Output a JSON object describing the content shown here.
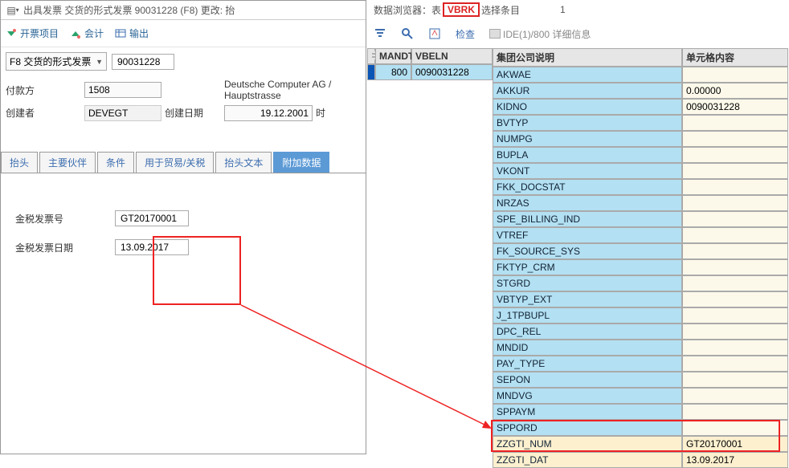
{
  "left": {
    "title": "出具发票 交货的形式发票 90031228   (F8) 更改: 抬",
    "toolbar": {
      "billing_item": "开票项目",
      "accounting": "会计",
      "output": "输出"
    },
    "type_label": "F8 交货的形式发票",
    "doc_number": "90031228",
    "fields": {
      "payer_label": "付款方",
      "payer_value": "1508",
      "payer_desc": "Deutsche Computer AG / Hauptstrasse",
      "creator_label": "创建者",
      "creator_value": "DEVEGT",
      "created_date_label": "创建日期",
      "created_date_value": "19.12.2001",
      "time_label": "时"
    },
    "tabs": {
      "t1": "抬头",
      "t2": "主要伙伴",
      "t3": "条件",
      "t4": "用于贸易/关税",
      "t5": "抬头文本",
      "t6": "附加数据"
    },
    "addl": {
      "gti_num_label": "金税发票号",
      "gti_num_value": "GT20170001",
      "gti_date_label": "金税发票日期",
      "gti_date_value": "13.09.2017"
    }
  },
  "right": {
    "title_prefix": "数据浏览器：表",
    "table_name": "VBRK",
    "title_suffix": "选择条目",
    "count": "1",
    "toolbar": {
      "check": "检查"
    },
    "breadcrumb": "IDE(1)/800 详细信息",
    "list_header": {
      "mandt": "MANDT",
      "vbeln": "VBELN"
    },
    "list_row": {
      "mandt": "800",
      "vbeln": "0090031228"
    },
    "detail_header": {
      "label": "集团公司说明",
      "value": "单元格内容"
    },
    "rows": [
      {
        "k": "AKWAE",
        "v": ""
      },
      {
        "k": "AKKUR",
        "v": "0.00000"
      },
      {
        "k": "KIDNO",
        "v": "0090031228"
      },
      {
        "k": "BVTYP",
        "v": ""
      },
      {
        "k": "NUMPG",
        "v": ""
      },
      {
        "k": "BUPLA",
        "v": ""
      },
      {
        "k": "VKONT",
        "v": ""
      },
      {
        "k": "FKK_DOCSTAT",
        "v": ""
      },
      {
        "k": "NRZAS",
        "v": ""
      },
      {
        "k": "SPE_BILLING_IND",
        "v": ""
      },
      {
        "k": "VTREF",
        "v": ""
      },
      {
        "k": "FK_SOURCE_SYS",
        "v": ""
      },
      {
        "k": "FKTYP_CRM",
        "v": ""
      },
      {
        "k": "STGRD",
        "v": ""
      },
      {
        "k": "VBTYP_EXT",
        "v": ""
      },
      {
        "k": "J_1TPBUPL",
        "v": ""
      },
      {
        "k": "DPC_REL",
        "v": ""
      },
      {
        "k": "MNDID",
        "v": ""
      },
      {
        "k": "PAY_TYPE",
        "v": ""
      },
      {
        "k": "SEPON",
        "v": ""
      },
      {
        "k": "MNDVG",
        "v": ""
      },
      {
        "k": "SPPAYM",
        "v": ""
      },
      {
        "k": "SPPORD",
        "v": ""
      },
      {
        "k": "ZZGTI_NUM",
        "v": "GT20170001"
      },
      {
        "k": "ZZGTI_DAT",
        "v": "13.09.2017"
      }
    ]
  }
}
